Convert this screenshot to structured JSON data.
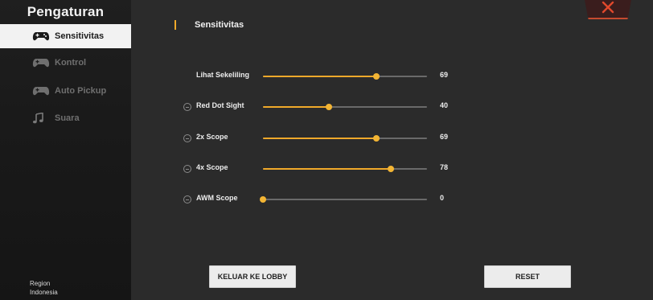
{
  "sidebar": {
    "title": "Pengaturan",
    "items": [
      {
        "label": "Sensitivitas",
        "icon": "gamepad-icon"
      },
      {
        "label": "Kontrol",
        "icon": "gamepad-icon"
      },
      {
        "label": "Auto Pickup",
        "icon": "gamepad-icon"
      },
      {
        "label": "Suara",
        "icon": "music-note-icon"
      }
    ],
    "region_label": "Region",
    "region_value": "Indonesia"
  },
  "section": {
    "title": "Sensitivitas"
  },
  "sliders": [
    {
      "label": "Lihat Sekeliling",
      "value": "69",
      "fraction": 0.69
    },
    {
      "label": "Red Dot Sight",
      "value": "40",
      "fraction": 0.4
    },
    {
      "label": "2x Scope",
      "value": "69",
      "fraction": 0.69
    },
    {
      "label": "4x Scope",
      "value": "78",
      "fraction": 0.78
    },
    {
      "label": "AWM Scope",
      "value": "0",
      "fraction": 0.0
    }
  ],
  "buttons": {
    "lobby": "KELUAR KE LOBBY",
    "reset": "RESET"
  },
  "colors": {
    "accent": "#f0a92a",
    "close": "#d4442a",
    "active_bg": "#f2f2f2"
  }
}
